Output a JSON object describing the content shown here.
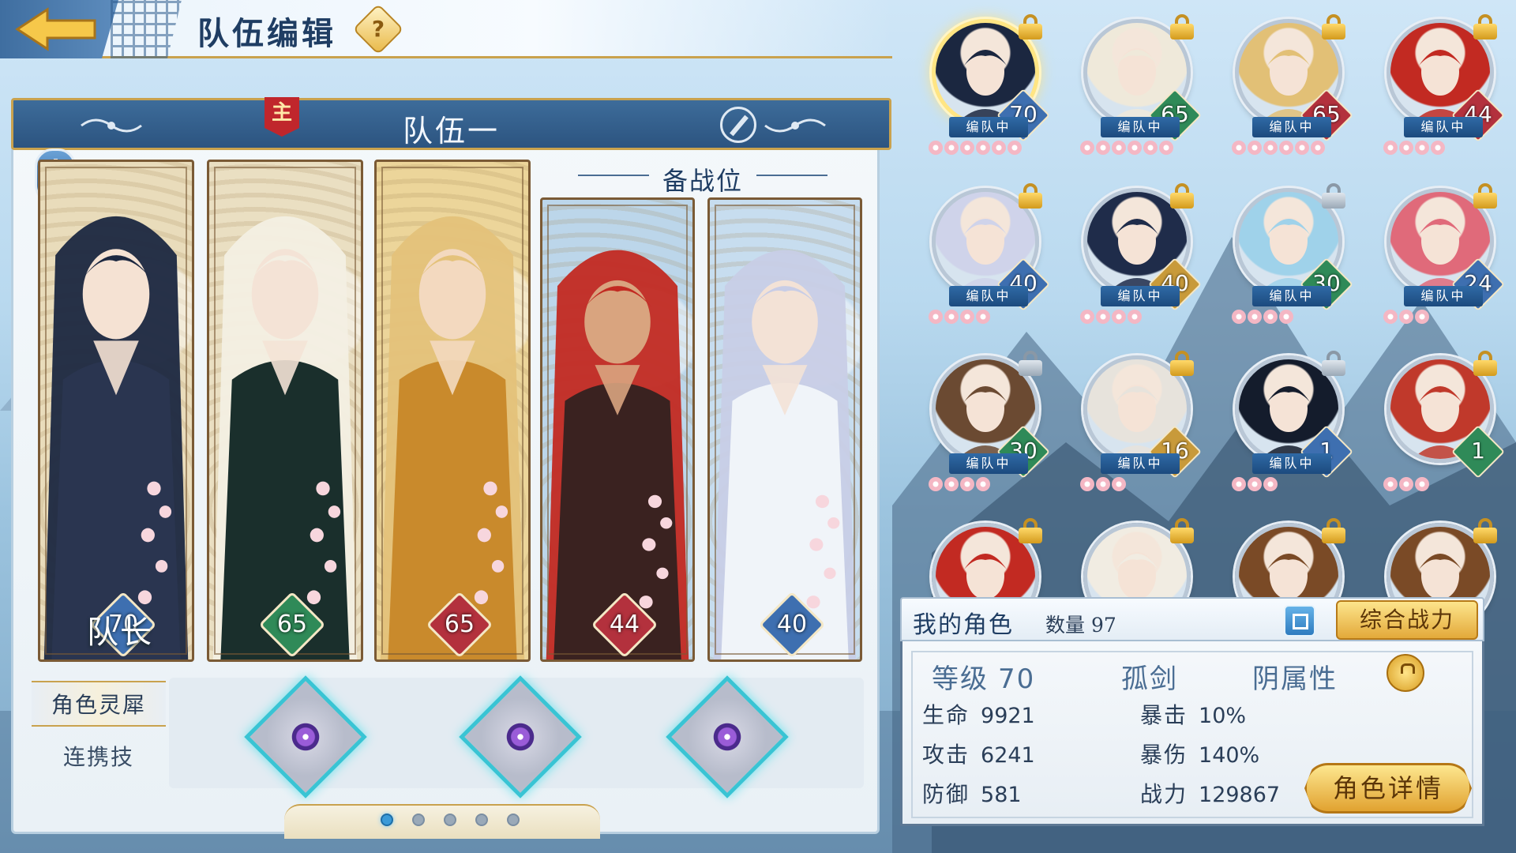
{
  "header": {
    "title": "队伍编辑",
    "help_icon": "?"
  },
  "team": {
    "name": "队伍一",
    "leader_badge": "主",
    "reserve_label": "备战位",
    "captain_label": "队长",
    "members": [
      {
        "level": "70",
        "slot": "leader",
        "colors": {
          "bg": "#e9dcbb",
          "hair": "#1b2740",
          "outfit": "#2a3550",
          "skin": "#f5e2d3",
          "diamond": "#3e6fb0"
        }
      },
      {
        "level": "65",
        "slot": "main",
        "colors": {
          "bg": "#eadfc2",
          "hair": "#f3efe3",
          "outfit": "#1a2f2c",
          "skin": "#f4e3d6",
          "diamond": "#2f8a58"
        }
      },
      {
        "level": "65",
        "slot": "main",
        "colors": {
          "bg": "#ecd59a",
          "hair": "#e4c27a",
          "outfit": "#c98a2c",
          "skin": "#f3d9bf",
          "diamond": "#b3313d"
        }
      },
      {
        "level": "44",
        "slot": "reserve",
        "colors": {
          "bg": "#bcd6ea",
          "hair": "#c22a22",
          "outfit": "#3a2220",
          "skin": "#d9a47f",
          "diamond": "#b3313d"
        }
      },
      {
        "level": "40",
        "slot": "reserve",
        "colors": {
          "bg": "#c7ddef",
          "hair": "#c8cde6",
          "outfit": "#f0f4f9",
          "skin": "#f3e2d6",
          "diamond": "#3e6fb0"
        }
      }
    ]
  },
  "tabs": {
    "spirit": "角色灵犀",
    "combo": "连携技"
  },
  "pager": {
    "pages": 5,
    "active": 0
  },
  "roster": {
    "title": "我的角色",
    "count_label": "数量 97",
    "sort_label": "综合战力",
    "in_team_label": "编队中",
    "characters": [
      {
        "level": "70",
        "in_team": true,
        "selected": true,
        "lock": "gold",
        "petals": 6,
        "hair": "#1b2740",
        "ring": "#3e6fb0",
        "diamond": "#3e6fb0"
      },
      {
        "level": "65",
        "in_team": true,
        "lock": "gold",
        "petals": 6,
        "hair": "#efe9da",
        "ring": "#b8c8d8",
        "diamond": "#2f8a58"
      },
      {
        "level": "65",
        "in_team": true,
        "lock": "gold",
        "petals": 6,
        "hair": "#e2c076",
        "ring": "#d9b86a",
        "diamond": "#b3313d"
      },
      {
        "level": "44",
        "in_team": true,
        "lock": "gold",
        "petals": 4,
        "hair": "#c22a22",
        "ring": "#b8c8d8",
        "diamond": "#b3313d"
      },
      {
        "level": "40",
        "in_team": true,
        "lock": "gold",
        "petals": 4,
        "hair": "#cfd3ea",
        "ring": "#b8c8d8",
        "diamond": "#3e6fb0"
      },
      {
        "level": "40",
        "in_team": true,
        "lock": "gold",
        "petals": 4,
        "hair": "#1f2c4a",
        "ring": "#b8c8d8",
        "diamond": "#c89a3a"
      },
      {
        "level": "30",
        "in_team": true,
        "lock": "grey",
        "petals": 4,
        "hair": "#9fd2ea",
        "ring": "#b8c8d8",
        "diamond": "#2f8a58"
      },
      {
        "level": "24",
        "in_team": true,
        "lock": "gold",
        "petals": 3,
        "hair": "#e06a7a",
        "ring": "#b8c8d8",
        "diamond": "#3e6fb0"
      },
      {
        "level": "30",
        "in_team": true,
        "lock": "grey",
        "petals": 4,
        "hair": "#6b4a32",
        "ring": "#b8c8d8",
        "diamond": "#2f8a58"
      },
      {
        "level": "16",
        "in_team": true,
        "lock": "gold",
        "petals": 3,
        "hair": "#e7e3dc",
        "ring": "#b8c8d8",
        "diamond": "#c89a3a"
      },
      {
        "level": "1",
        "in_team": true,
        "lock": "grey",
        "petals": 3,
        "hair": "#141c2c",
        "ring": "#b8c8d8",
        "diamond": "#3e6fb0"
      },
      {
        "level": "1",
        "in_team": false,
        "lock": "gold",
        "petals": 3,
        "hair": "#c0392b",
        "ring": "#b8c8d8",
        "diamond": "#2f8a58"
      },
      {
        "level": "",
        "in_team": false,
        "lock": "gold",
        "petals": 0,
        "hair": "#c22a22",
        "ring": "#b8c8d8",
        "diamond": "#b3313d"
      },
      {
        "level": "",
        "in_team": false,
        "lock": "gold",
        "petals": 0,
        "hair": "#f1ece2",
        "ring": "#b8c8d8",
        "diamond": "#3e6fb0"
      },
      {
        "level": "",
        "in_team": false,
        "lock": "gold",
        "petals": 0,
        "hair": "#7a4a26",
        "ring": "#b8c8d8",
        "diamond": "#2f8a58"
      },
      {
        "level": "",
        "in_team": false,
        "lock": "gold",
        "petals": 0,
        "hair": "#7a4a26",
        "ring": "#b8c8d8",
        "diamond": "#2f8a58"
      }
    ]
  },
  "selected": {
    "level_label": "等级",
    "level": "70",
    "class": "孤剑",
    "element": "阴属性",
    "stats": {
      "hp_label": "生命",
      "hp": "9921",
      "atk_label": "攻击",
      "atk": "6241",
      "def_label": "防御",
      "def": "581",
      "crit_label": "暴击",
      "crit": "10%",
      "critdmg_label": "暴伤",
      "critdmg": "140%",
      "power_label": "战力",
      "power": "129867"
    },
    "detail_button": "角色详情"
  },
  "colors": {
    "accent_gold": "#c9a24e",
    "header_blue": "#2c5480",
    "text_dark": "#1f3d63"
  }
}
